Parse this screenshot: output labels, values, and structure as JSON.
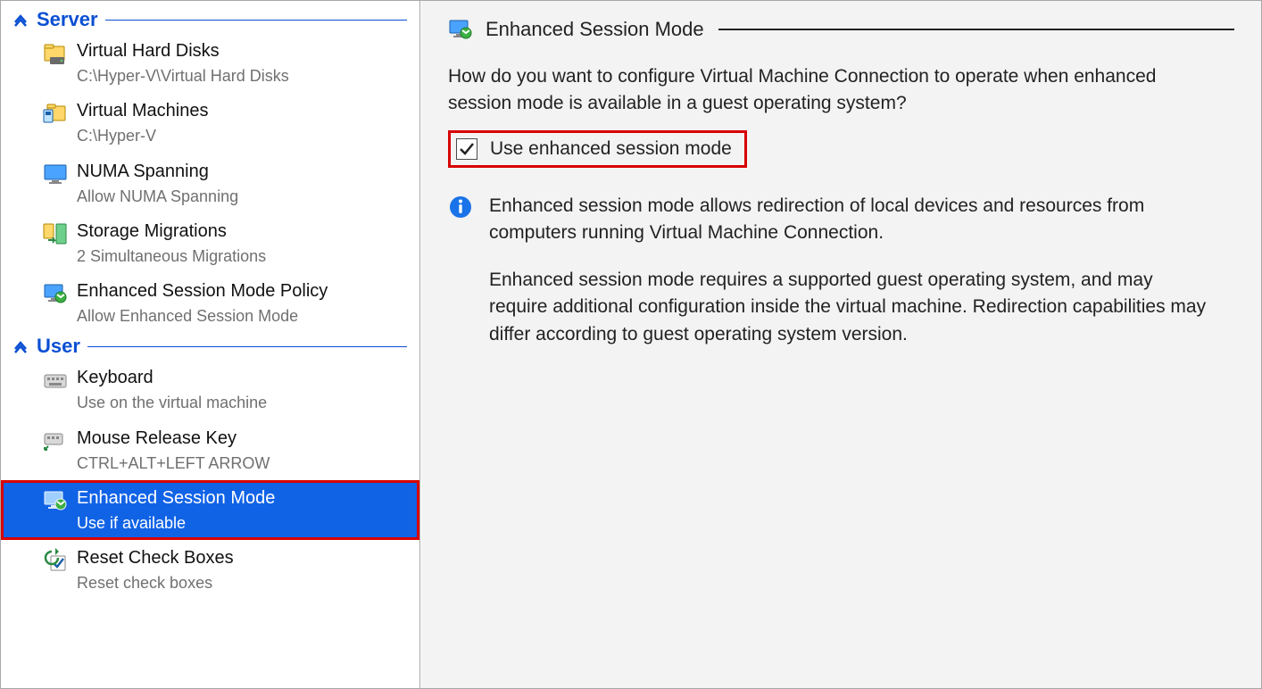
{
  "sidebar": {
    "sections": {
      "server": {
        "title": "Server",
        "items": [
          {
            "title": "Virtual Hard Disks",
            "subtitle": "C:\\Hyper-V\\Virtual Hard Disks"
          },
          {
            "title": "Virtual Machines",
            "subtitle": "C:\\Hyper-V"
          },
          {
            "title": "NUMA Spanning",
            "subtitle": "Allow NUMA Spanning"
          },
          {
            "title": "Storage Migrations",
            "subtitle": "2 Simultaneous Migrations"
          },
          {
            "title": "Enhanced Session Mode Policy",
            "subtitle": "Allow Enhanced Session Mode"
          }
        ]
      },
      "user": {
        "title": "User",
        "items": [
          {
            "title": "Keyboard",
            "subtitle": "Use on the virtual machine"
          },
          {
            "title": "Mouse Release Key",
            "subtitle": "CTRL+ALT+LEFT ARROW"
          },
          {
            "title": "Enhanced Session Mode",
            "subtitle": "Use if available",
            "selected": true,
            "highlighted": true
          },
          {
            "title": "Reset Check Boxes",
            "subtitle": "Reset check boxes"
          }
        ]
      }
    }
  },
  "content": {
    "header_title": "Enhanced Session Mode",
    "question": "How do you want to configure Virtual Machine Connection to operate when enhanced session mode is available in a guest operating system?",
    "checkbox_label": "Use enhanced session mode",
    "checkbox_checked": true,
    "info_paragraph_1": "Enhanced session mode allows redirection of local devices and resources from computers running Virtual Machine Connection.",
    "info_paragraph_2": "Enhanced session mode requires a supported guest operating system, and may require additional configuration inside the virtual machine. Redirection capabilities may differ according to guest operating system version."
  }
}
